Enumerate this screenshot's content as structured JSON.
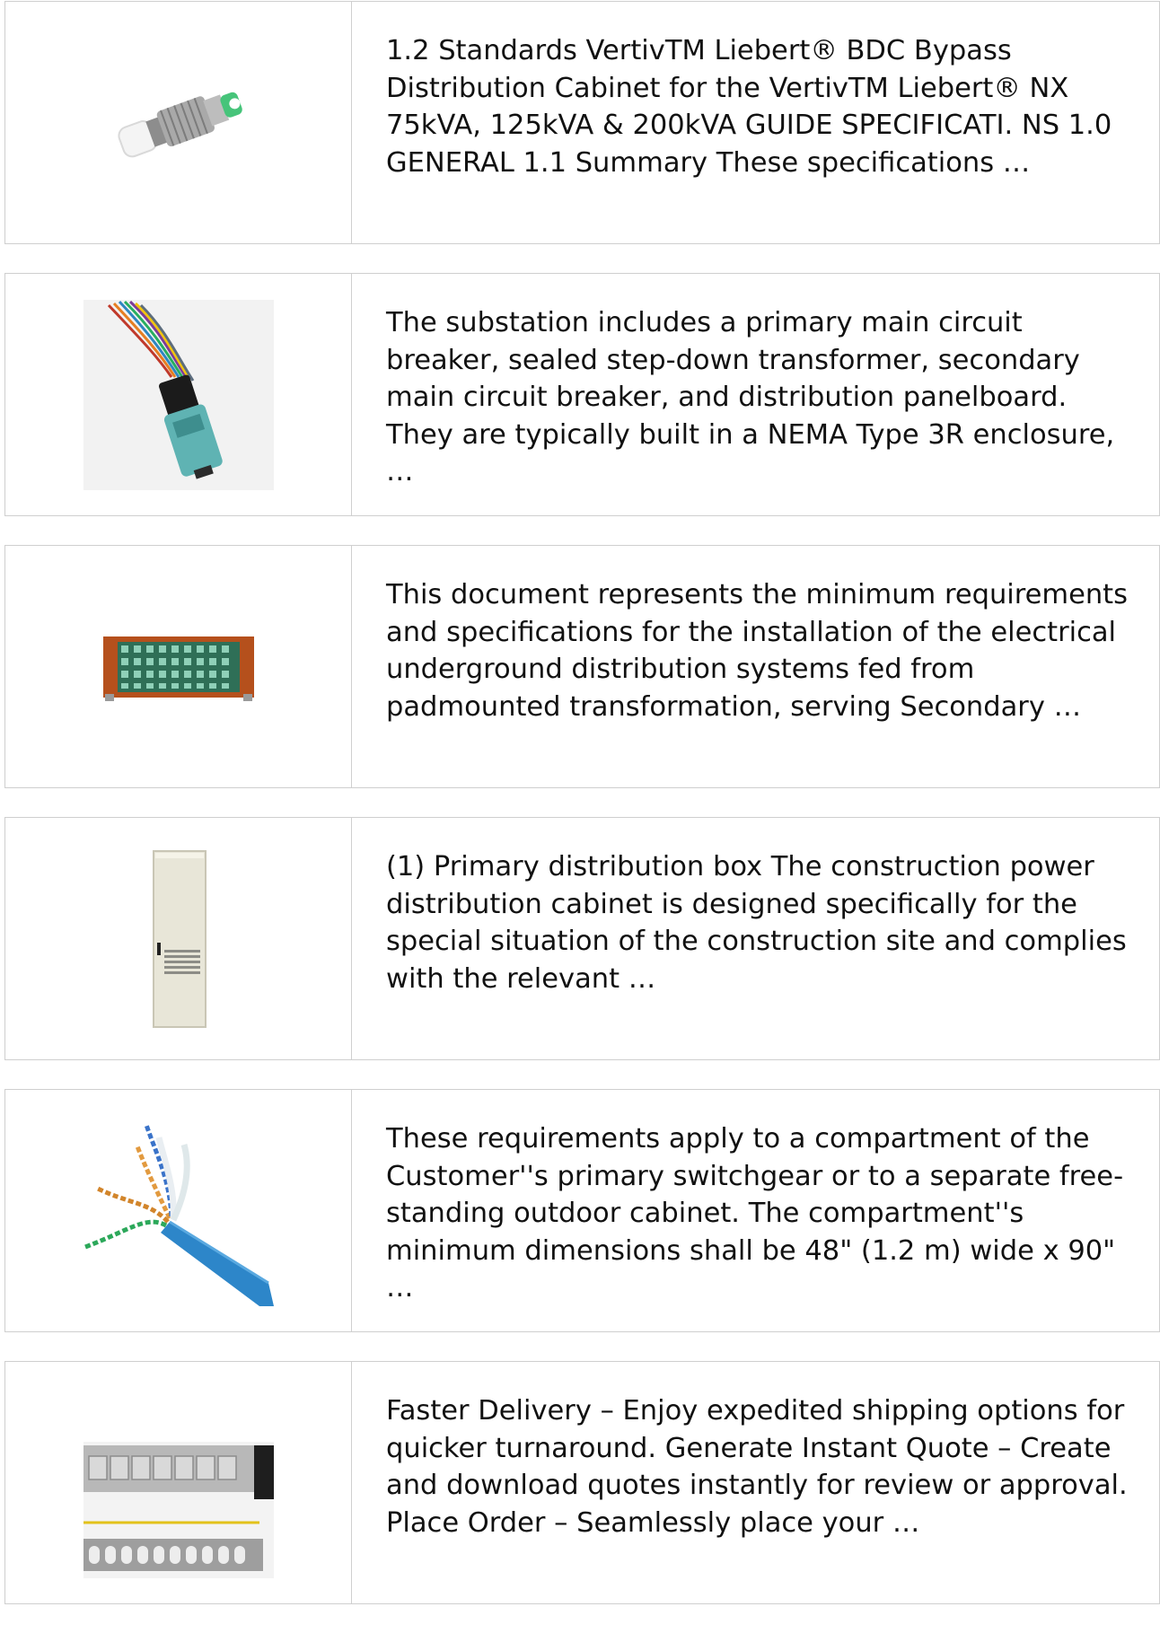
{
  "results": [
    {
      "thumbnail_icon": "fiber-connector-adapter-icon",
      "snippet": "1.2 Standards VertivTM Liebert® BDC Bypass Distribution Cabinet for the VertivTM Liebert® NX 75kVA, 125kVA & 200kVA GUIDE SPECIFICATI. NS 1.0 GENERAL 1.1 Summary These specifications …"
    },
    {
      "thumbnail_icon": "mpo-fiber-connector-icon",
      "snippet": "The substation includes a primary main circuit breaker, sealed step-down transformer, secondary main circuit breaker, and distribution panelboard. They are typically built in a NEMA Type 3R enclosure, …"
    },
    {
      "thumbnail_icon": "fiber-patch-panel-icon",
      "snippet": "This document represents the minimum requirements and specifications for the installation of the electrical underground distribution systems fed from padmounted transformation, serving Secondary …"
    },
    {
      "thumbnail_icon": "distribution-cabinet-icon",
      "snippet": "(1) Primary distribution box The construction power distribution cabinet is designed specifically for the special situation of the construction site and complies with the relevant …"
    },
    {
      "thumbnail_icon": "network-cable-icon",
      "snippet": "These requirements apply to a compartment of the Customer''s primary switchgear or to a separate free-standing outdoor cabinet. The compartment''s minimum dimensions shall be 48\" (1.2 m) wide x 90\" …"
    },
    {
      "thumbnail_icon": "rj45-patch-panel-icon",
      "snippet": "Faster Delivery – Enjoy expedited shipping options for quicker turnaround. Generate Instant Quote – Create and download quotes instantly for review or approval. Place Order – Seamlessly place your …"
    }
  ]
}
